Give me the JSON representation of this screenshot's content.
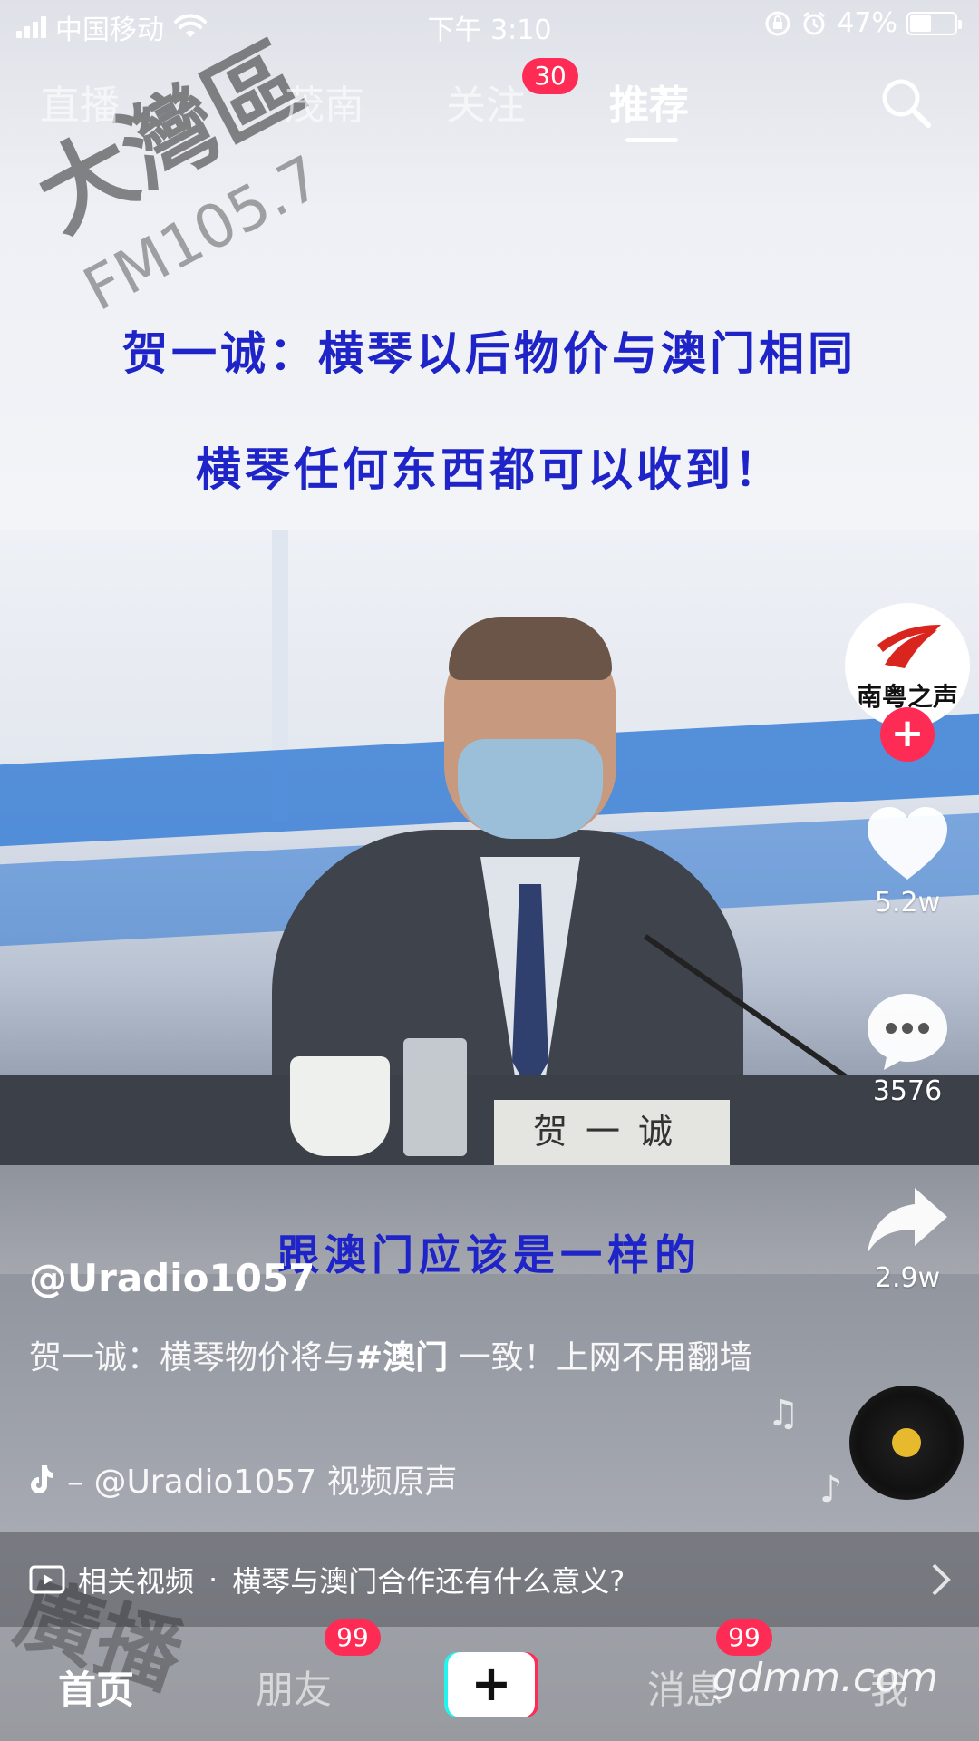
{
  "status_bar": {
    "carrier": "中国移动",
    "time": "下午 3:10",
    "battery": "47%",
    "battery_level": 0.47
  },
  "top_tabs": [
    {
      "label": "直播",
      "active": false
    },
    {
      "label": "茂南",
      "active": false
    },
    {
      "label": "关注",
      "active": false,
      "badge": "30"
    },
    {
      "label": "推荐",
      "active": true
    }
  ],
  "video": {
    "headline_line1": "贺一诚：横琴以后物价与澳门相同",
    "headline_line2": "横琴任何东西都可以收到！",
    "subtitle": "跟澳门应该是一样的",
    "nameplate": "贺一诚",
    "watermark_station": "大灣區",
    "watermark_freq": "FM105.7",
    "watermark_bottom_left": "廣播",
    "watermark_bottom_right": "gdmm.com"
  },
  "right_rail": {
    "avatar_text": "南粤之声",
    "follow_symbol": "+",
    "likes": "5.2w",
    "comments": "3576",
    "shares": "2.9w"
  },
  "caption": {
    "author": "@Uradio1057",
    "desc_before": "贺一诚：横琴物价将与",
    "desc_tag": "#澳门",
    "desc_after": " 一致！上网不用翻墙",
    "music": "– @Uradio1057    视频原声"
  },
  "related": {
    "label": "相关视频",
    "separator": "·",
    "title": "横琴与澳门合作还有什么意义?"
  },
  "bottom_nav": {
    "home": "首页",
    "friends": "朋友",
    "friends_badge": "99",
    "create": "+",
    "messages": "消息",
    "messages_badge": "99",
    "me": "我"
  },
  "colors": {
    "accent_red": "#fe2c55",
    "accent_cyan": "#25f4ee",
    "headline_blue": "#1e24c8"
  }
}
